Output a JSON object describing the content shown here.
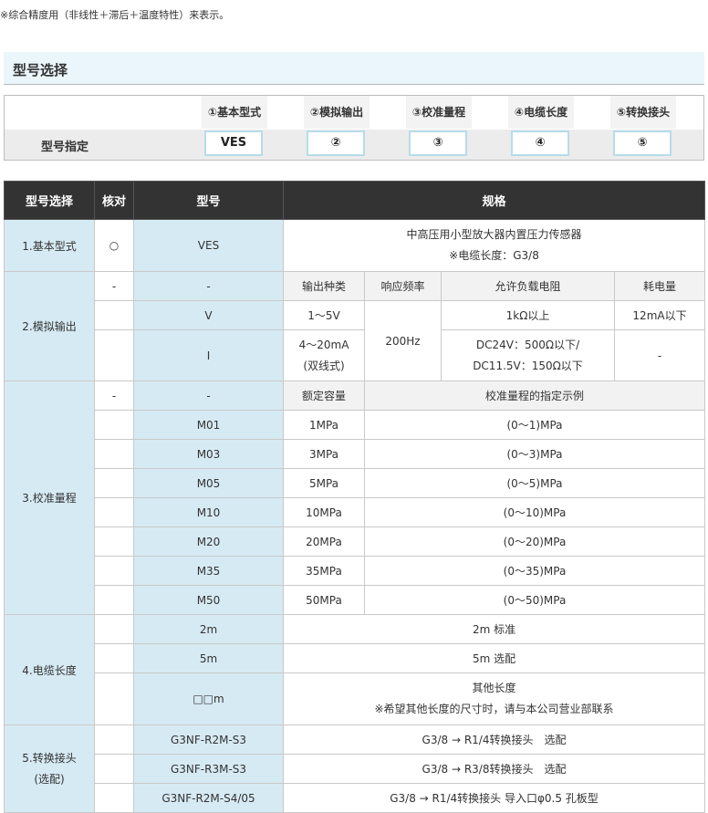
{
  "note": "※综合精度用（非线性＋滞后＋温度特性）来表示。",
  "section_title": "型号选择",
  "model_spec": {
    "label": "型号指定",
    "columns": [
      {
        "header": "①基本型式",
        "value": "VES"
      },
      {
        "header": "②模拟输出",
        "value": "②"
      },
      {
        "header": "③校准量程",
        "value": "③"
      },
      {
        "header": "④电缆长度",
        "value": "④"
      },
      {
        "header": "⑤转换接头",
        "value": "⑤"
      }
    ]
  },
  "table": {
    "headers": [
      "型号选择",
      "核对",
      "型号",
      "规格"
    ],
    "basic": {
      "category": "1.基本型式",
      "check": "○",
      "model": "VES",
      "spec_line1": "中高压用小型放大器内置压力传感器",
      "spec_line2": "※电缆长度：G3/8"
    },
    "analog": {
      "category": "2.模拟输出",
      "sub_check": "-",
      "sub_model": "-",
      "sub_headers": [
        "输出种类",
        "响应频率",
        "允许负载电阻",
        "耗电量"
      ],
      "freq": "200Hz",
      "rows": [
        {
          "model": "V",
          "type": "1～5V",
          "load": "1kΩ以上",
          "power": "12mA以下"
        },
        {
          "model": "I",
          "type_line1": "4～20mA",
          "type_line2": "(双线式)",
          "load_line1": "DC24V：500Ω以下/",
          "load_line2": "DC11.5V：150Ω以下",
          "power": "-"
        }
      ]
    },
    "range": {
      "category": "3.校准量程",
      "sub_check": "-",
      "sub_model": "-",
      "sub_headers": [
        "额定容量",
        "校准量程的指定示例"
      ],
      "rows": [
        {
          "model": "M01",
          "capacity": "1MPa",
          "example": "(0～1)MPa"
        },
        {
          "model": "M03",
          "capacity": "3MPa",
          "example": "(0～3)MPa"
        },
        {
          "model": "M05",
          "capacity": "5MPa",
          "example": "(0～5)MPa"
        },
        {
          "model": "M10",
          "capacity": "10MPa",
          "example": "(0～10)MPa"
        },
        {
          "model": "M20",
          "capacity": "20MPa",
          "example": "(0～20)MPa"
        },
        {
          "model": "M35",
          "capacity": "35MPa",
          "example": "(0～35)MPa"
        },
        {
          "model": "M50",
          "capacity": "50MPa",
          "example": "(0～50)MPa"
        }
      ]
    },
    "cable": {
      "category": "4.电缆长度",
      "rows": [
        {
          "model": "2m",
          "spec": "2m 标准"
        },
        {
          "model": "5m",
          "spec": "5m 选配"
        },
        {
          "model": "□□m",
          "spec_line1": "其他长度",
          "spec_line2": "※希望其他长度的尺寸时，请与本公司营业部联系"
        }
      ]
    },
    "adapter": {
      "category_line1": "5.转换接头",
      "category_line2": "(选配)",
      "rows": [
        {
          "model": "G3NF-R2M-S3",
          "spec": "G3/8 → R1/4转换接头　选配"
        },
        {
          "model": "G3NF-R3M-S3",
          "spec": "G3/8 → R3/8转换接头　选配"
        },
        {
          "model": "G3NF-R2M-S4/05",
          "spec": "G3/8 → R1/4转换接头 导入口φ0.5 孔板型"
        }
      ]
    }
  }
}
